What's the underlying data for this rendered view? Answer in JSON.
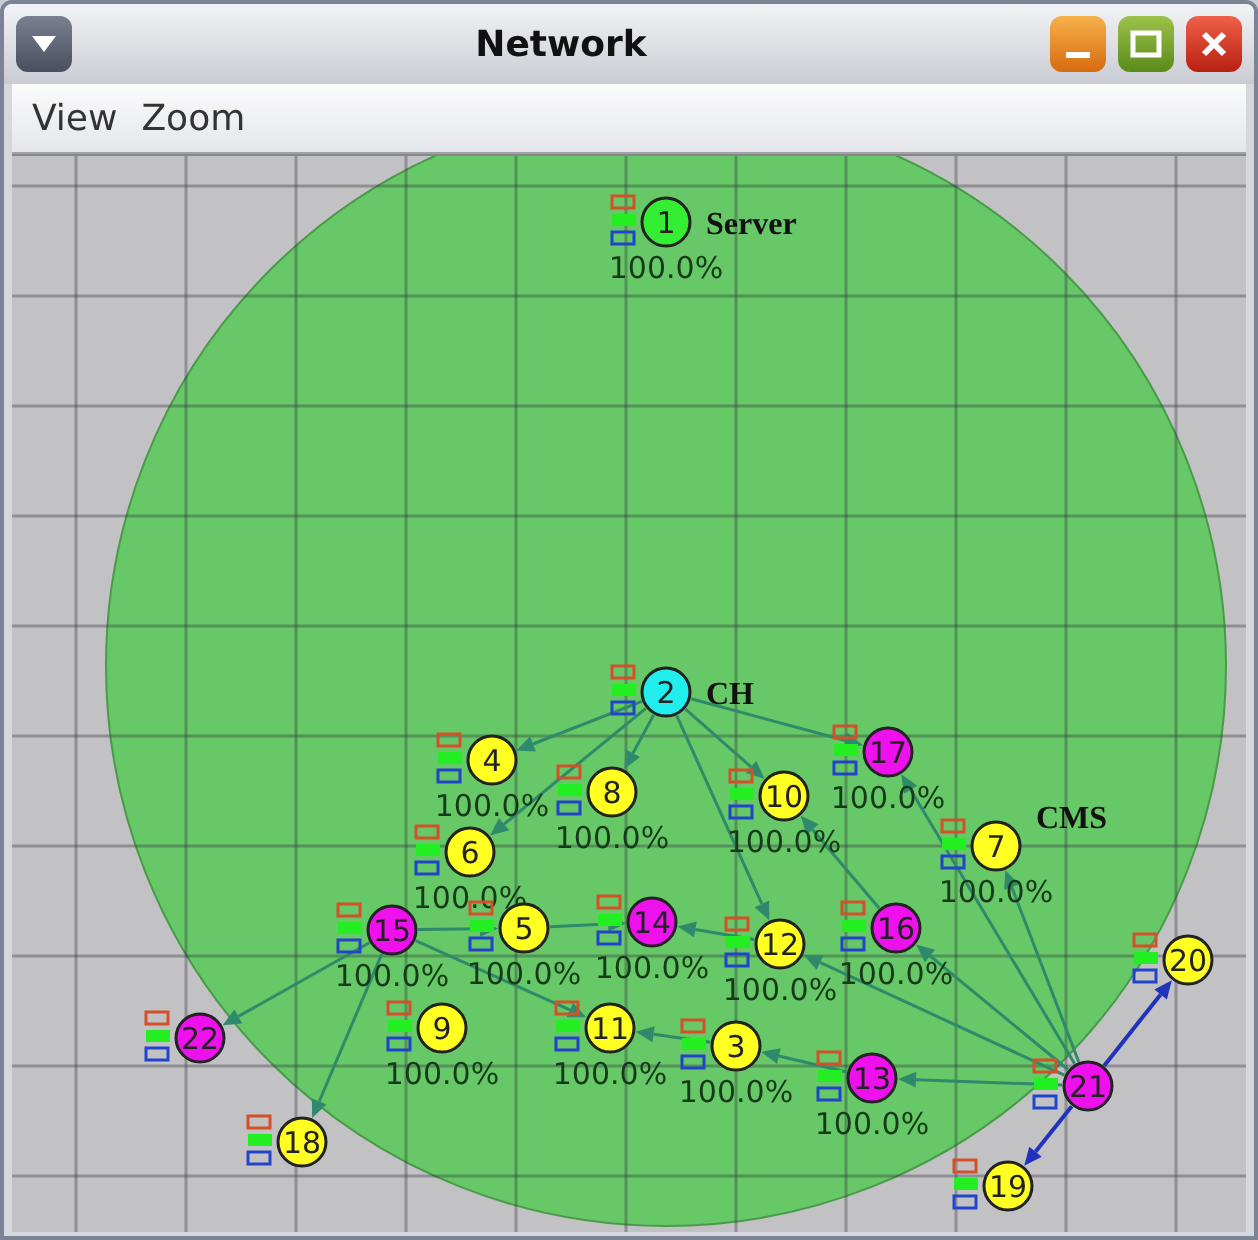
{
  "window": {
    "title": "Network"
  },
  "menu": [
    {
      "label": "View"
    },
    {
      "label": "Zoom"
    }
  ],
  "nodes": [
    {
      "label": "1",
      "color": "#33ee33",
      "reading": "100.0%",
      "role": "Server"
    },
    {
      "label": "2",
      "color": "#22eeee",
      "role": "CH"
    },
    {
      "label": "4",
      "color": "#ffff22",
      "reading": "100.0%"
    },
    {
      "label": "8",
      "color": "#ffff22",
      "reading": "100.0%"
    },
    {
      "label": "6",
      "color": "#ffff22",
      "reading": "100.0%"
    },
    {
      "label": "10",
      "color": "#ffff22",
      "reading": "100.0%"
    },
    {
      "label": "17",
      "color": "#ee11ee",
      "reading": "100.0%"
    },
    {
      "label": "7",
      "color": "#ffff22",
      "reading": "100.0%",
      "role": "CMS"
    },
    {
      "label": "15",
      "color": "#ee11ee",
      "reading": "100.0%"
    },
    {
      "label": "5",
      "color": "#ffff22",
      "reading": "100.0%"
    },
    {
      "label": "14",
      "color": "#ee11ee",
      "reading": "100.0%"
    },
    {
      "label": "12",
      "color": "#ffff22",
      "reading": "100.0%"
    },
    {
      "label": "16",
      "color": "#ee11ee",
      "reading": "100.0%"
    },
    {
      "label": "20",
      "color": "#ffff22"
    },
    {
      "label": "22",
      "color": "#ee11ee"
    },
    {
      "label": "9",
      "color": "#ffff22",
      "reading": "100.0%"
    },
    {
      "label": "11",
      "color": "#ffff22",
      "reading": "100.0%"
    },
    {
      "label": "3",
      "color": "#ffff22",
      "reading": "100.0%"
    },
    {
      "label": "13",
      "color": "#ee11ee",
      "reading": "100.0%"
    },
    {
      "label": "21",
      "color": "#ee11ee"
    },
    {
      "label": "18",
      "color": "#ffff22"
    },
    {
      "label": "19",
      "color": "#ffff22"
    }
  ]
}
